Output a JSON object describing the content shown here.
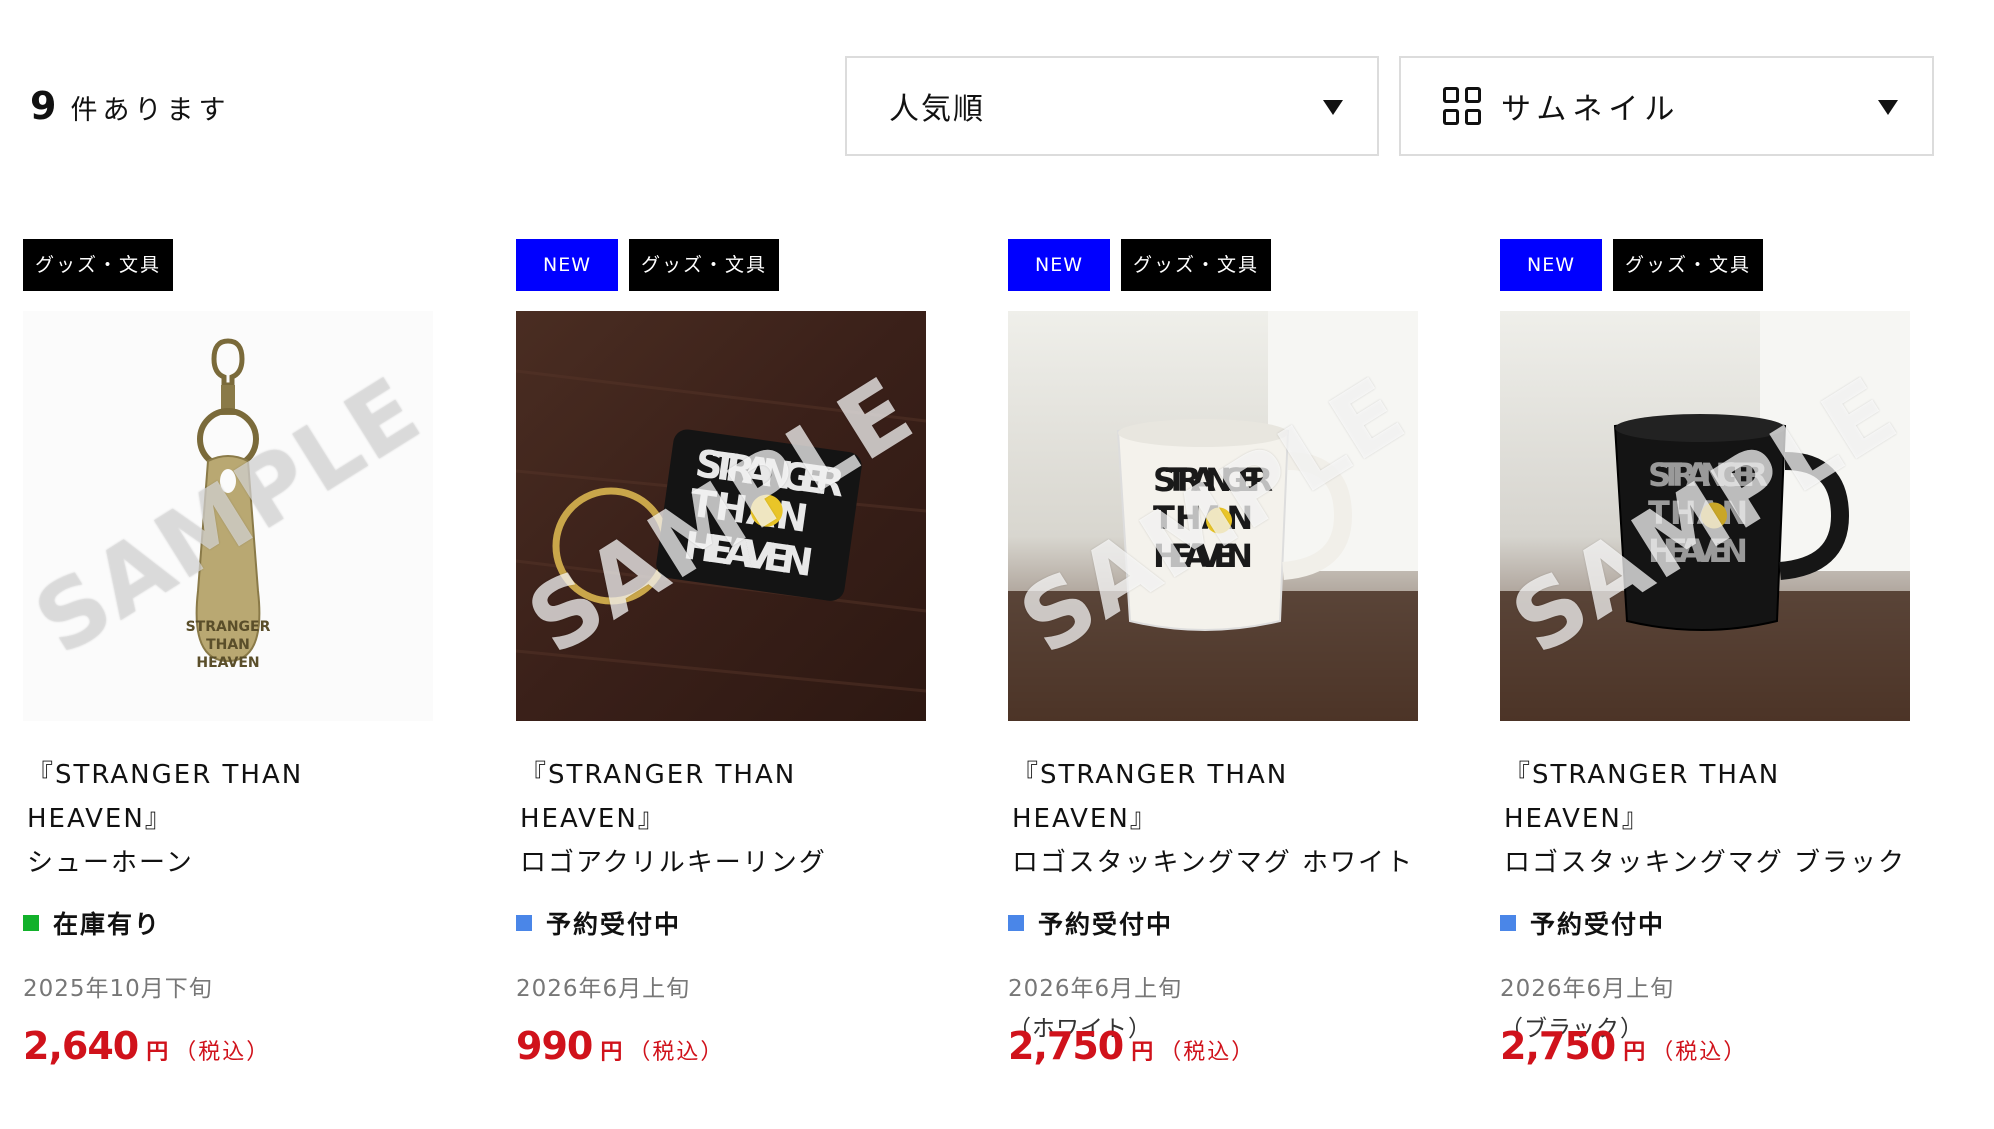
{
  "result_count": {
    "number": "9",
    "suffix": "件あります"
  },
  "sort_select": {
    "value": "人気順"
  },
  "view_select": {
    "value": "サムネイル",
    "icon": "grid-icon"
  },
  "sample_watermark": "SAMPLE",
  "products": [
    {
      "tags": [
        "グッズ・文具"
      ],
      "is_new": false,
      "name_line1": "『STRANGER THAN HEAVEN』",
      "name_line2": "シューホーン",
      "status": "在庫有り",
      "status_color": "#12b12b",
      "date": "2025年10月下旬",
      "variant": "",
      "price": "2,640",
      "yen": "円",
      "tax": "（税込）"
    },
    {
      "tags": [
        "グッズ・文具"
      ],
      "is_new": true,
      "name_line1": "『STRANGER THAN HEAVEN』",
      "name_line2": "ロゴアクリルキーリング",
      "status": "予約受付中",
      "status_color": "#4a86e8",
      "date": "2026年6月上旬",
      "variant": "",
      "price": "990",
      "yen": "円",
      "tax": "（税込）"
    },
    {
      "tags": [
        "グッズ・文具"
      ],
      "is_new": true,
      "name_line1": "『STRANGER THAN HEAVEN』",
      "name_line2": "ロゴスタッキングマグ ホワイト",
      "status": "予約受付中",
      "status_color": "#4a86e8",
      "date": "2026年6月上旬",
      "variant": "（ホワイト）",
      "price": "2,750",
      "yen": "円",
      "tax": "（税込）"
    },
    {
      "tags": [
        "グッズ・文具"
      ],
      "is_new": true,
      "name_line1": "『STRANGER THAN HEAVEN』",
      "name_line2": "ロゴスタッキングマグ ブラック",
      "status": "予約受付中",
      "status_color": "#4a86e8",
      "date": "2026年6月上旬",
      "variant": "（ブラック）",
      "price": "2,750",
      "yen": "円",
      "tax": "（税込）"
    }
  ],
  "new_label": "NEW",
  "logo_text": {
    "l1": "STRANGER",
    "l2": "THAN",
    "l3": "HEAVEN"
  }
}
